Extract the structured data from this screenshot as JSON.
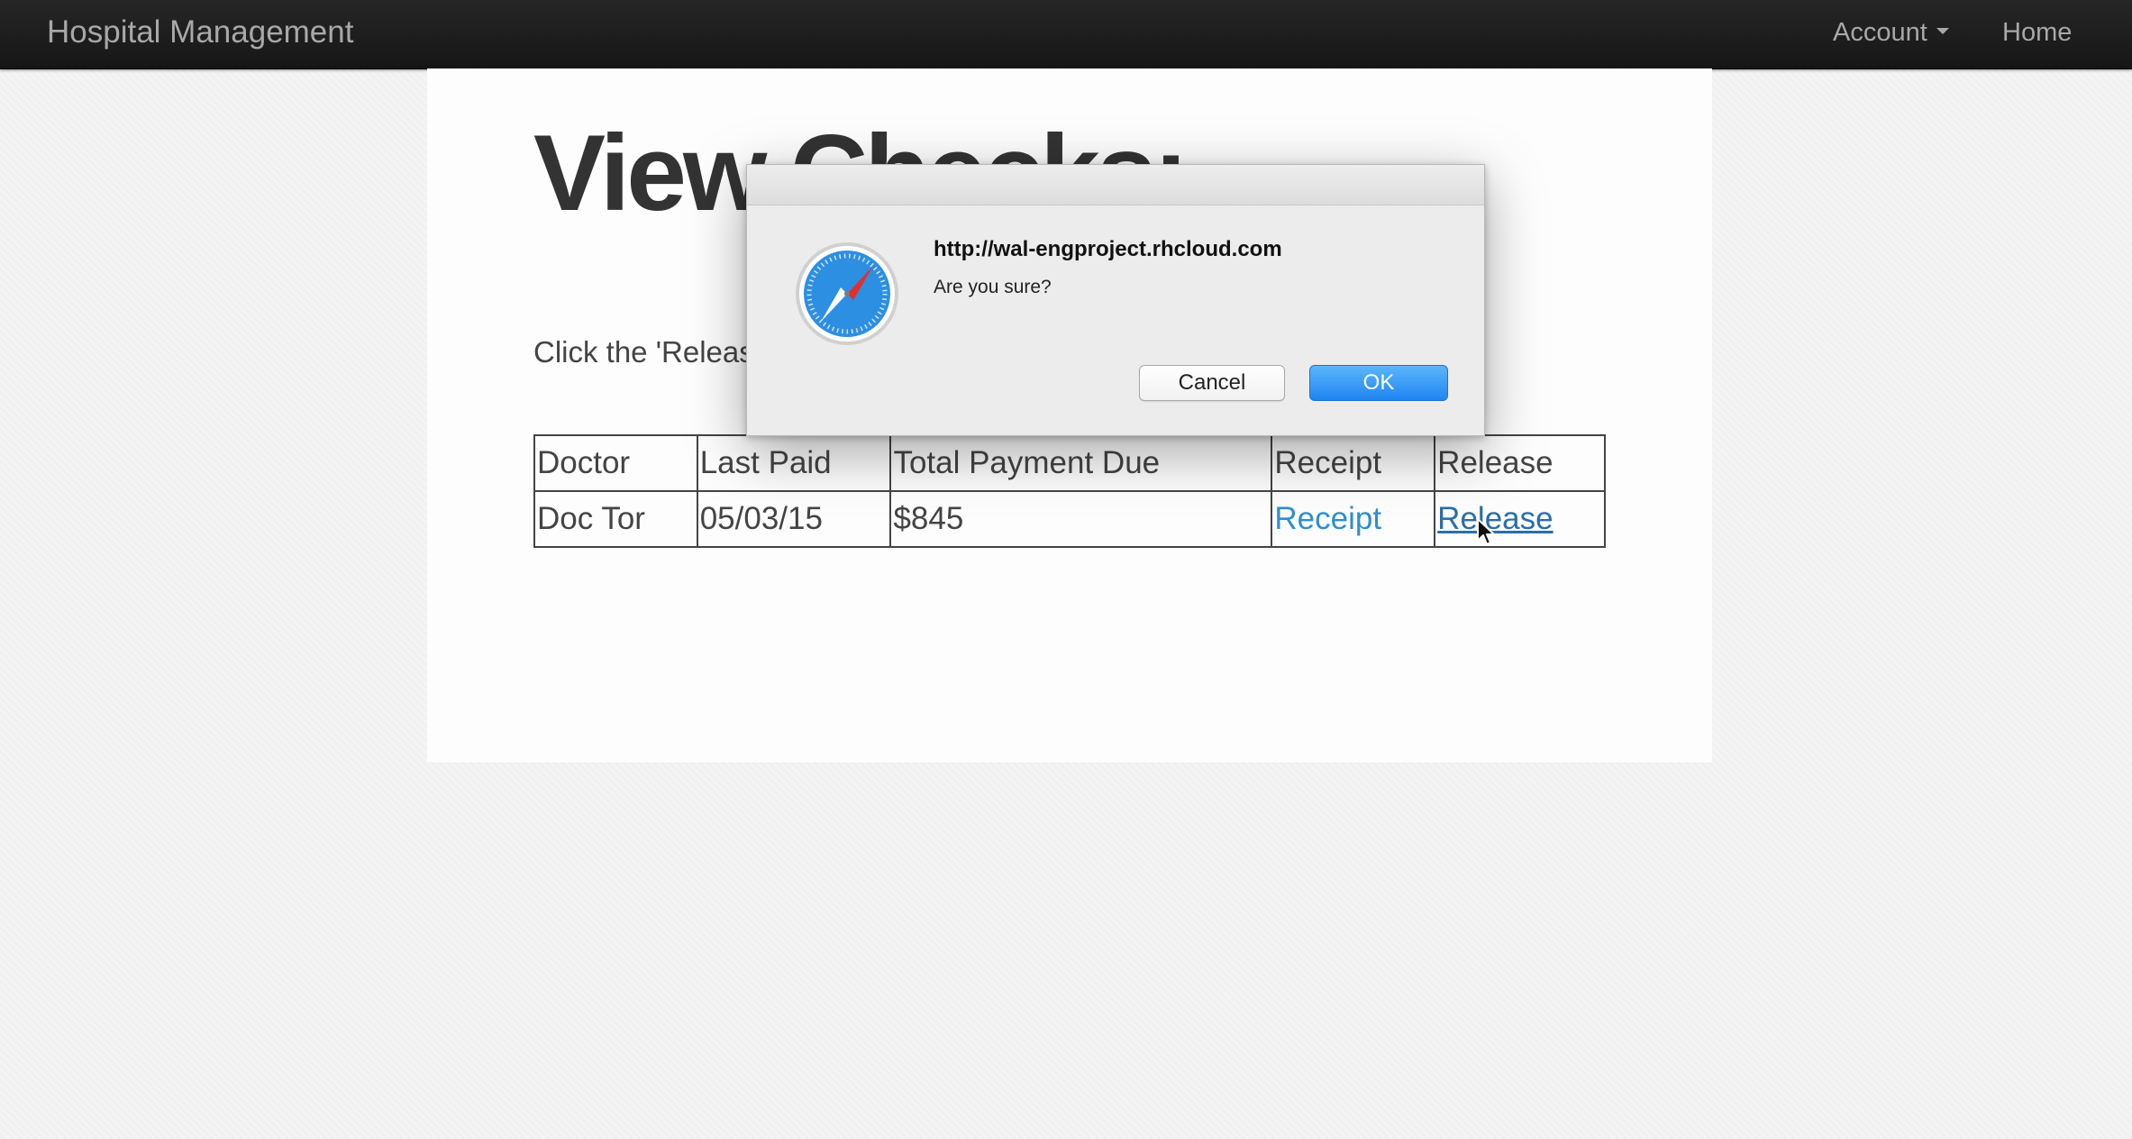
{
  "navbar": {
    "brand": "Hospital Management",
    "account_label": "Account",
    "home_label": "Home"
  },
  "page": {
    "title": "View Checks:",
    "instructions": "Click the 'Release' link to release a check."
  },
  "table": {
    "headers": [
      "Doctor",
      "Last Paid",
      "Total Payment Due",
      "Receipt",
      "Release"
    ],
    "rows": [
      {
        "doctor": "Doc Tor",
        "last_paid": "05/03/15",
        "total_due": "$845",
        "receipt": "Receipt",
        "release": "Release"
      }
    ]
  },
  "dialog": {
    "origin": "http://wal-engproject.rhcloud.com",
    "message": "Are you sure?",
    "cancel_label": "Cancel",
    "ok_label": "OK"
  },
  "colors": {
    "navbar_bg": "#1b1b1b",
    "link": "#2f8fd0",
    "ok_button": "#2c8ff5"
  },
  "icons": {
    "dialog": "safari-compass-icon",
    "account_dropdown": "caret-down-icon",
    "pointer": "mouse-cursor-icon"
  }
}
